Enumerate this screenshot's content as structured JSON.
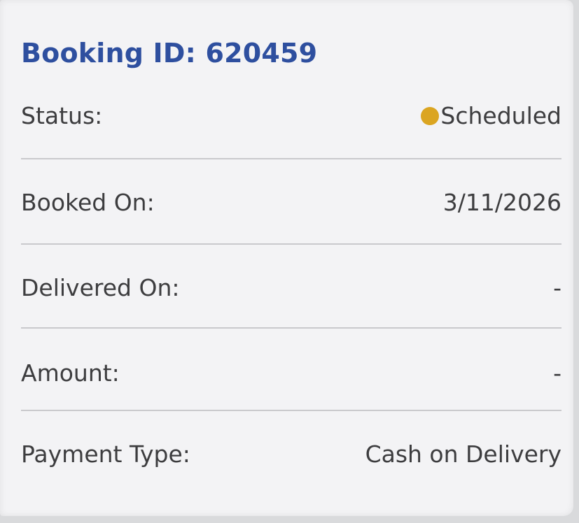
{
  "booking": {
    "title": "Booking ID: 620459"
  },
  "details": {
    "status_label": "Status:",
    "status_value": "Scheduled",
    "booked_on_label": "Booked On:",
    "booked_on_value": "3/11/2026",
    "delivered_on_label": "Delivered On:",
    "delivered_on_value": "-",
    "amount_label": "Amount:",
    "amount_value": "-",
    "payment_type_label": "Payment Type:",
    "payment_type_value": "Cash on Delivery"
  },
  "colors": {
    "title": "#2e4f9f",
    "status_dot": "#dba521",
    "text": "#3d3d3f",
    "divider": "#c9c9cc"
  },
  "icons": {
    "status_indicator": "status-dot-icon"
  }
}
